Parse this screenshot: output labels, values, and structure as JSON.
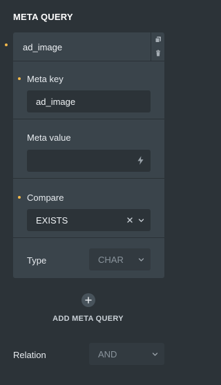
{
  "section": {
    "title": "META QUERY"
  },
  "item": {
    "title": "ad_image",
    "copy_icon": "copy-icon",
    "delete_icon": "trash-icon"
  },
  "fields": {
    "meta_key": {
      "label": "Meta key",
      "value": "ad_image"
    },
    "meta_value": {
      "label": "Meta value",
      "value": "",
      "icon": "lightning-bolt-icon"
    },
    "compare": {
      "label": "Compare",
      "value": "EXISTS"
    },
    "type": {
      "label": "Type",
      "value": "CHAR"
    }
  },
  "add": {
    "label": "ADD META QUERY",
    "icon": "plus-icon"
  },
  "relation": {
    "label": "Relation",
    "value": "AND"
  },
  "colors": {
    "background": "#2c3338",
    "card": "#3a444b",
    "input": "#2c3338",
    "accent_dot": "#f2b84b"
  }
}
